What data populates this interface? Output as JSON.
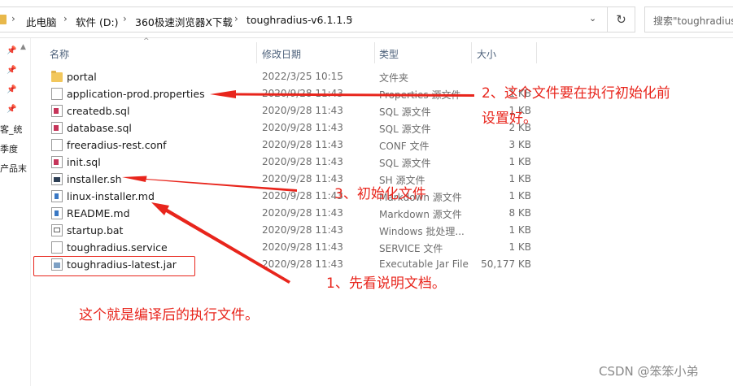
{
  "address_bar": {
    "crumbs": [
      "此电脑",
      "软件 (D:)",
      "360极速浏览器X下载",
      "toughradius-v6.1.1.5"
    ],
    "search_placeholder": "搜索\"toughradius"
  },
  "nav_pane": {
    "texts": [
      "客_统",
      "季度",
      "产品末"
    ]
  },
  "columns": {
    "name": "名称",
    "modified": "修改日期",
    "type": "类型",
    "size": "大小"
  },
  "files": [
    {
      "name": "portal",
      "date": "2022/3/25 10:15",
      "type": "文件夹",
      "size": "",
      "icon": "folder-icon"
    },
    {
      "name": "application-prod.properties",
      "date": "2020/9/28 11:43",
      "type": "Properties 源文件",
      "size": "1 KB",
      "icon": "properties-file-icon"
    },
    {
      "name": "createdb.sql",
      "date": "2020/9/28 11:43",
      "type": "SQL 源文件",
      "size": "1 KB",
      "icon": "sql-file-icon"
    },
    {
      "name": "database.sql",
      "date": "2020/9/28 11:43",
      "type": "SQL 源文件",
      "size": "2 KB",
      "icon": "sql-file-icon"
    },
    {
      "name": "freeradius-rest.conf",
      "date": "2020/9/28 11:43",
      "type": "CONF 文件",
      "size": "3 KB",
      "icon": "conf-file-icon"
    },
    {
      "name": "init.sql",
      "date": "2020/9/28 11:43",
      "type": "SQL 源文件",
      "size": "1 KB",
      "icon": "sql-file-icon"
    },
    {
      "name": "installer.sh",
      "date": "2020/9/28 11:43",
      "type": "SH 源文件",
      "size": "1 KB",
      "icon": "shell-file-icon"
    },
    {
      "name": "linux-installer.md",
      "date": "2020/9/28 11:43",
      "type": "Markdown 源文件",
      "size": "1 KB",
      "icon": "markdown-file-icon"
    },
    {
      "name": "README.md",
      "date": "2020/9/28 11:43",
      "type": "Markdown 源文件",
      "size": "8 KB",
      "icon": "markdown-file-icon"
    },
    {
      "name": "startup.bat",
      "date": "2020/9/28 11:43",
      "type": "Windows 批处理...",
      "size": "1 KB",
      "icon": "batch-file-icon"
    },
    {
      "name": "toughradius.service",
      "date": "2020/9/28 11:43",
      "type": "SERVICE 文件",
      "size": "1 KB",
      "icon": "service-file-icon"
    },
    {
      "name": "toughradius-latest.jar",
      "date": "2020/9/28 11:43",
      "type": "Executable Jar File",
      "size": "50,177 KB",
      "icon": "jar-file-icon"
    }
  ],
  "annotations": {
    "note2_line1": "2、这个文件要在执行初始化前",
    "note2_line2": "设置好。",
    "note3": "3、初始化文件",
    "note1": "1、先看说明文档。",
    "note_jar": "这个就是编译后的执行文件。",
    "color": "#e8251c"
  },
  "watermark": "CSDN @笨笨小弟"
}
